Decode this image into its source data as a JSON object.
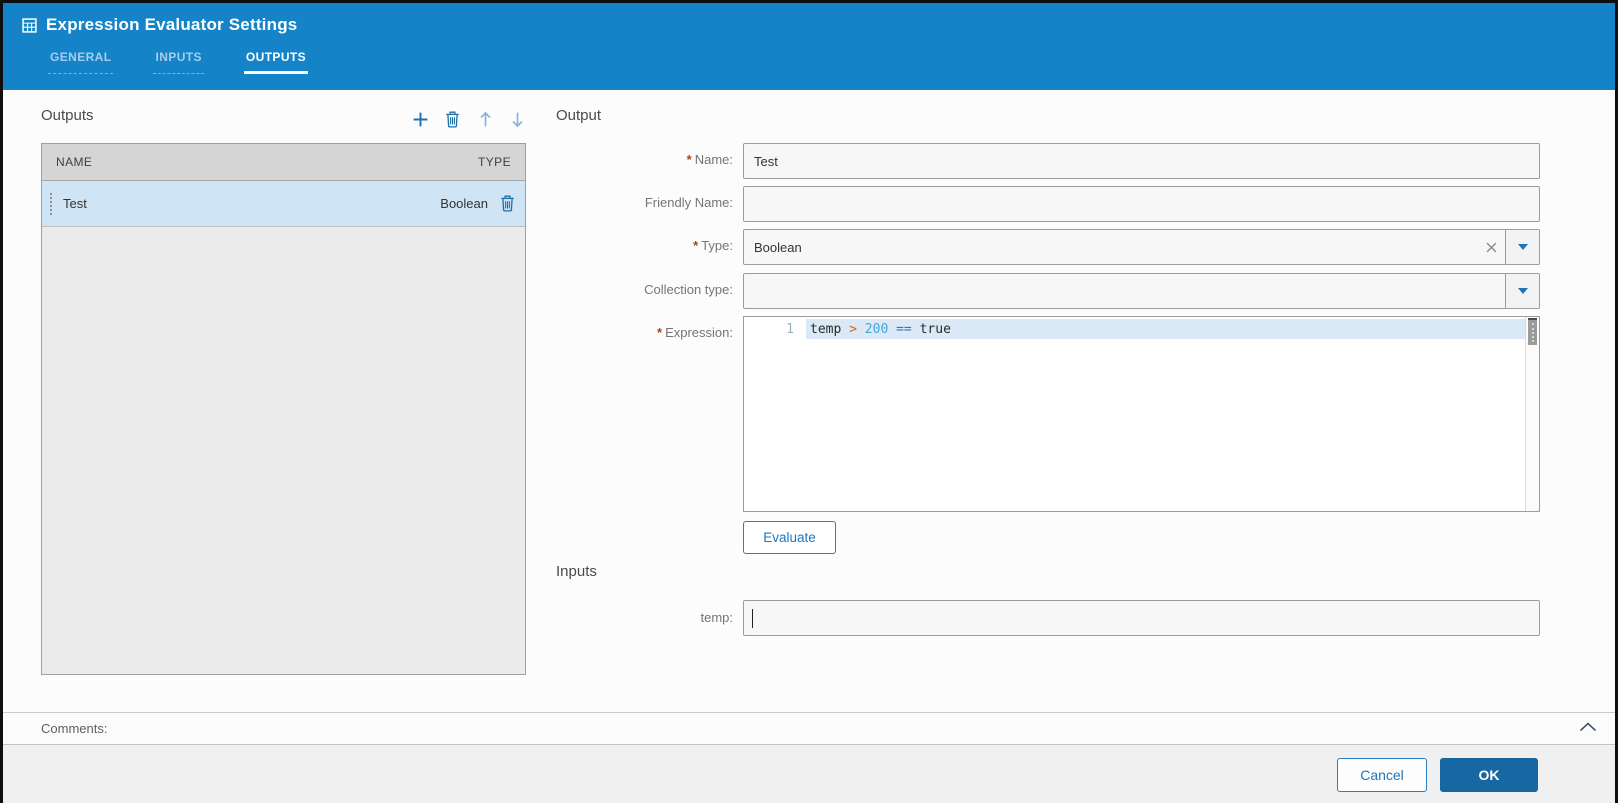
{
  "header": {
    "title": "Expression Evaluator Settings",
    "icon": "grid-table",
    "tabs": [
      {
        "label": "GENERAL",
        "active": false
      },
      {
        "label": "INPUTS",
        "active": false
      },
      {
        "label": "OUTPUTS",
        "active": true
      }
    ]
  },
  "outputs_list": {
    "heading": "Outputs",
    "toolbar": [
      {
        "icon": "plus",
        "enabled": true
      },
      {
        "icon": "trash",
        "enabled": true
      },
      {
        "icon": "arrow-up",
        "enabled": false
      },
      {
        "icon": "arrow-down",
        "enabled": false
      }
    ],
    "columns": [
      "NAME",
      "TYPE"
    ],
    "rows": [
      {
        "name": "Test",
        "type": "Boolean",
        "selected": true
      }
    ]
  },
  "output_form": {
    "heading": "Output",
    "required_marker": "*",
    "name": {
      "label": "Name:",
      "required": true,
      "value": "Test"
    },
    "friendly_name": {
      "label": "Friendly Name:",
      "required": false,
      "value": ""
    },
    "type": {
      "label": "Type:",
      "required": true,
      "value": "Boolean",
      "clearable": true
    },
    "collection_type": {
      "label": "Collection type:",
      "required": false,
      "value": ""
    },
    "expression": {
      "label": "Expression:",
      "required": true,
      "line_number": "1",
      "code": "temp > 200 == true",
      "tokens": [
        {
          "text": "temp",
          "type": "plain"
        },
        {
          "text": " ",
          "type": "plain"
        },
        {
          "text": ">",
          "type": "operator"
        },
        {
          "text": " ",
          "type": "plain"
        },
        {
          "text": "200",
          "type": "number"
        },
        {
          "text": " ",
          "type": "plain"
        },
        {
          "text": "==",
          "type": "keyword-op"
        },
        {
          "text": " ",
          "type": "plain"
        },
        {
          "text": "true",
          "type": "plain"
        }
      ]
    },
    "evaluate_label": "Evaluate"
  },
  "inputs_section": {
    "heading": "Inputs",
    "fields": [
      {
        "label": "temp:",
        "value": ""
      }
    ]
  },
  "comments": {
    "label": "Comments:"
  },
  "footer": {
    "cancel_label": "Cancel",
    "ok_label": "OK"
  },
  "colors": {
    "header_bg": "#1583c7",
    "accent": "#2a7fc9",
    "ok_button_bg": "#1667a2",
    "selected_row_bg": "#cfe4f4",
    "table_header_bg": "#d5d5d5",
    "token_operator": "#c8651b",
    "token_number": "#41a8de",
    "token_keyword_op": "#2e79b8",
    "active_line_bg": "#dbe9f6"
  }
}
